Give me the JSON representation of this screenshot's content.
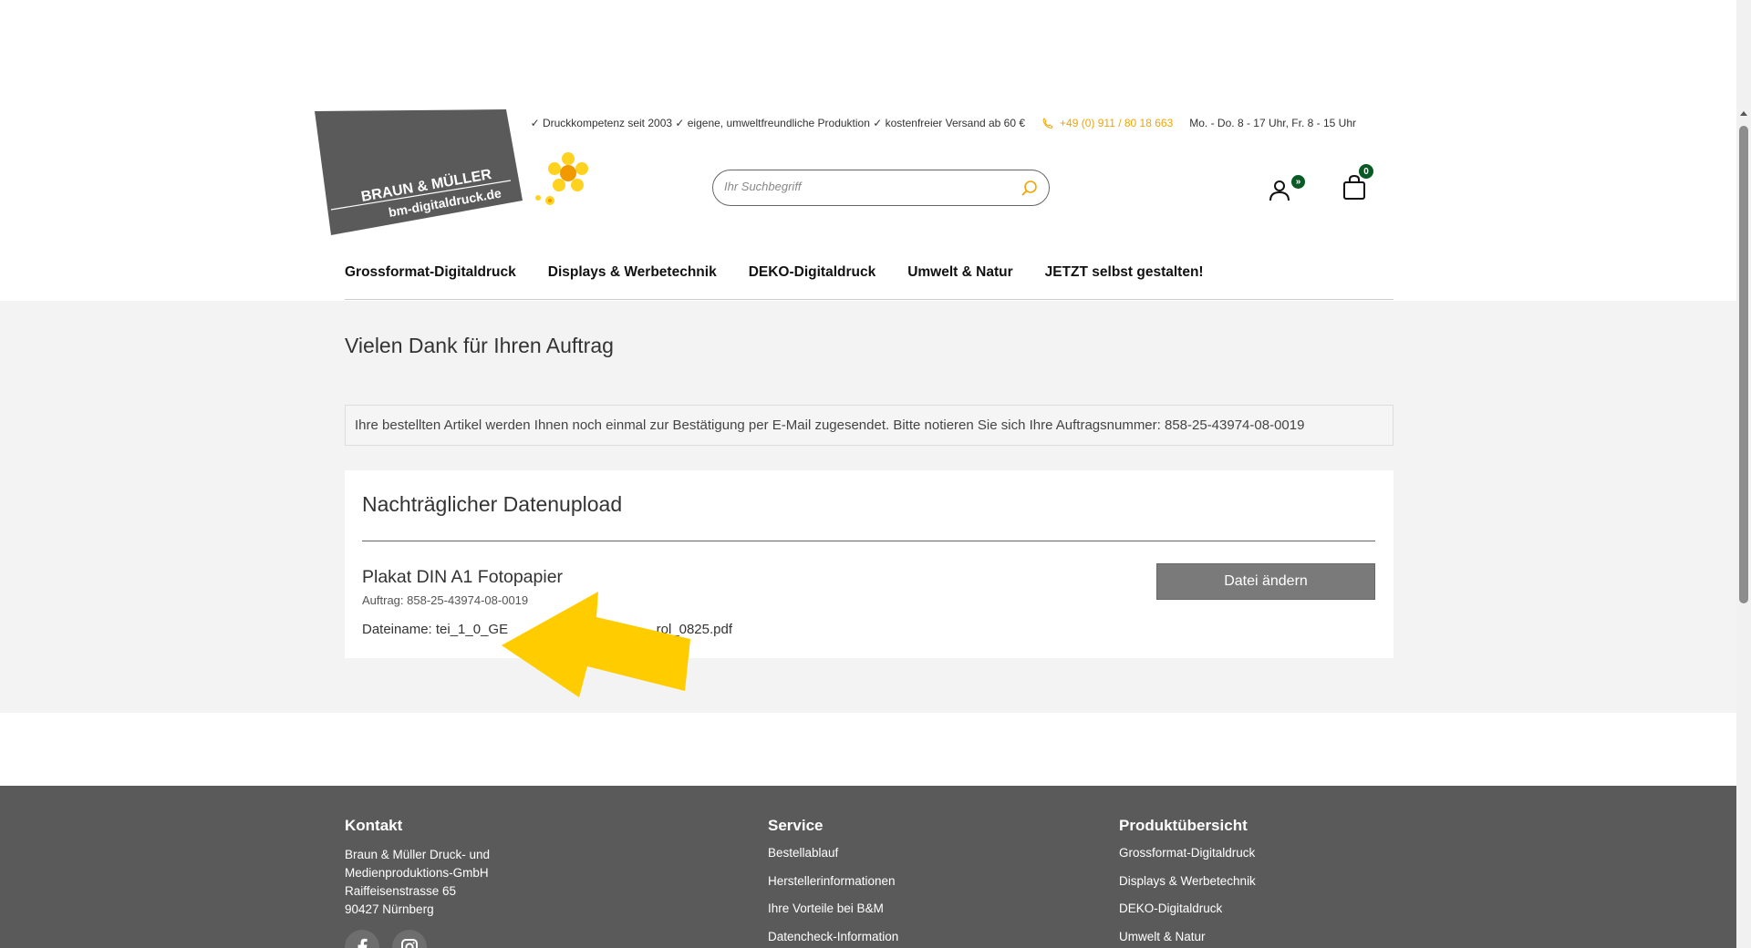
{
  "header": {
    "logo": {
      "brand_line1": "BRAUN & MÜLLER",
      "brand_line2": "bm-digitaldruck.de"
    },
    "topbar": {
      "usp_text": "✓ Druckkompetenz seit 2003 ✓ eigene, umweltfreundliche Produktion ✓ kostenfreier Versand ab 60 €",
      "phone": "+49 (0) 911 / 80 18 663",
      "hours": "Mo. - Do. 8 - 17 Uhr, Fr. 8 - 15 Uhr"
    },
    "search": {
      "placeholder": "Ihr Suchbegriff"
    },
    "account_badge": "»",
    "cart_count": "0",
    "nav": [
      "Grossformat-Digitaldruck",
      "Displays & Werbetechnik",
      "DEKO-Digitaldruck",
      "Umwelt & Natur",
      "JETZT selbst gestalten!"
    ]
  },
  "main": {
    "title": "Vielen Dank für Ihren Auftrag",
    "notice": "Ihre bestellten Artikel werden Ihnen noch einmal zur Bestätigung per E-Mail zugesendet. Bitte notieren Sie sich Ihre Auftragsnummer: 858-25-43974-08-0019",
    "upload": {
      "title": "Nachträglicher Datenupload",
      "item_name": "Plakat DIN A1 Fotopapier",
      "order_label": "Auftrag: 858-25-43974-08-0019",
      "file_label": "Dateiname: tei_1_0_GE",
      "file_suffix": "...rol_0825.pdf",
      "change_button": "Datei ändern"
    }
  },
  "footer": {
    "kontakt": {
      "heading": "Kontakt",
      "address": [
        "Braun & Müller Druck- und",
        "Medienproduktions-GmbH",
        "Raiffeisenstrasse 65",
        "90427 Nürnberg"
      ]
    },
    "service": {
      "heading": "Service",
      "links": [
        "Bestellablauf",
        "Herstellerinformationen",
        "Ihre Vorteile bei B&M",
        "Datencheck-Information"
      ]
    },
    "products": {
      "heading": "Produktübersicht",
      "links": [
        "Grossformat-Digitaldruck",
        "Displays & Werbetechnik",
        "DEKO-Digitaldruck",
        "Umwelt & Natur"
      ]
    }
  },
  "colors": {
    "accent_orange": "#f0a500",
    "badge_green": "#0a5a25",
    "logo_grey": "#5a5a5a",
    "arrow_yellow": "#ffcc00",
    "footer_bg": "#5a5a5a"
  }
}
